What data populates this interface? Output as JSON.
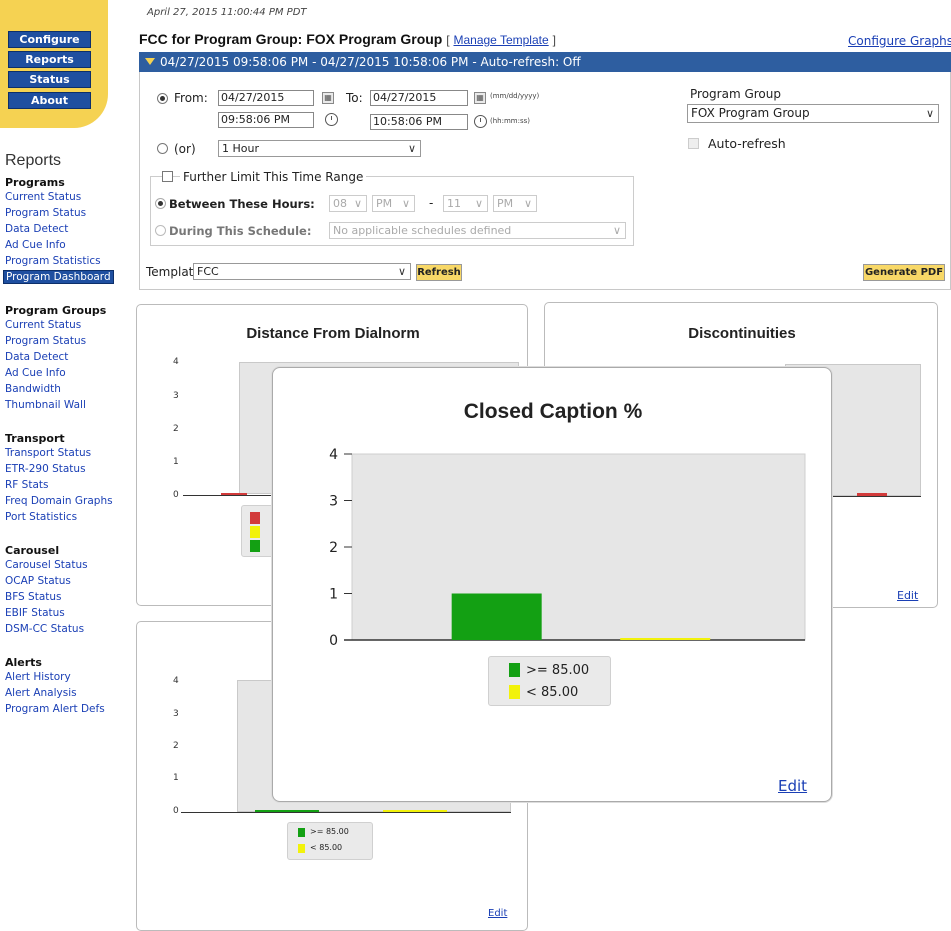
{
  "nav": {
    "buttons": [
      "Configure",
      "Reports",
      "Status",
      "About"
    ]
  },
  "sidebar": {
    "title": "Reports",
    "sections": [
      {
        "heading": "Programs",
        "items": [
          "Current Status",
          "Program Status",
          "Data Detect",
          "Ad Cue Info",
          "Program Statistics",
          "Program Dashboard"
        ],
        "active": "Program Dashboard"
      },
      {
        "heading": "Program Groups",
        "items": [
          "Current Status",
          "Program Status",
          "Data Detect",
          "Ad Cue Info",
          "Bandwidth",
          "Thumbnail Wall"
        ]
      },
      {
        "heading": "Transport",
        "items": [
          "Transport Status",
          "ETR-290 Status",
          "RF Stats",
          "Freq Domain Graphs",
          "Port Statistics"
        ]
      },
      {
        "heading": "Carousel",
        "items": [
          "Carousel Status",
          "OCAP Status",
          "BFS Status",
          "EBIF Status",
          "DSM-CC Status"
        ]
      },
      {
        "heading": "Alerts",
        "items": [
          "Alert History",
          "Alert Analysis",
          "Program Alert Defs"
        ]
      }
    ]
  },
  "header": {
    "timestamp": "April 27, 2015 11:00:44 PM PDT",
    "title": "FCC for Program Group: FOX Program Group",
    "bracket_open": "[",
    "bracket_close": "]",
    "manage_template": "Manage Template",
    "configure_graphs": "Configure Graphs",
    "range_bar": "04/27/2015 09:58:06 PM - 04/27/2015 10:58:06 PM  - Auto-refresh: Off"
  },
  "form": {
    "from_label": "From:",
    "from_date": "04/27/2015",
    "from_time": "09:58:06 PM",
    "to_label": "To:",
    "to_date": "04/27/2015",
    "to_time": "10:58:06 PM",
    "date_hint": "(mm/dd/yyyy)",
    "time_hint": "(hh:mm:ss)",
    "or_label": "(or)",
    "duration": "1 Hour",
    "further_limit": "Further Limit This Time Range",
    "between_label": "Between These Hours:",
    "between_from_hour": "08",
    "between_from_ampm": "PM",
    "dash": "-",
    "between_to_hour": "11",
    "between_to_ampm": "PM",
    "schedule_label": "During This Schedule:",
    "schedule_value": "No applicable schedules defined",
    "template_label": "Template:",
    "template_value": "FCC",
    "refresh": "Refresh",
    "generate_pdf": "Generate PDF",
    "program_group_label": "Program Group",
    "program_group_value": "FOX Program Group",
    "auto_refresh": "Auto-refresh"
  },
  "cards": {
    "dialnorm_title": "Distance From Dialnorm",
    "discontinuities_title": "Discontinuities",
    "edit": "Edit",
    "small_ticks": [
      "0",
      "1",
      "2",
      "3",
      "4"
    ],
    "small_legend": [
      ">= 85.00",
      "< 85.00"
    ]
  },
  "colors": {
    "green": "#13a013",
    "yellow": "#f2f20a",
    "red": "#d23a3a",
    "nav_blue": "#1f4fa0",
    "bar_blue": "#2e5ea0",
    "sidebar_yellow": "#f5d252"
  },
  "chart_data": {
    "type": "bar",
    "title": "Closed Caption %",
    "categories": [
      ">= 85.00",
      "< 85.00"
    ],
    "values": [
      1,
      0
    ],
    "colors": [
      "#13a013",
      "#f2f20a"
    ],
    "ylim": [
      0,
      4
    ],
    "yticks": [
      0,
      1,
      2,
      3,
      4
    ],
    "legend": [
      ">= 85.00",
      "< 85.00"
    ],
    "grid": false,
    "edit_label": "Edit"
  }
}
